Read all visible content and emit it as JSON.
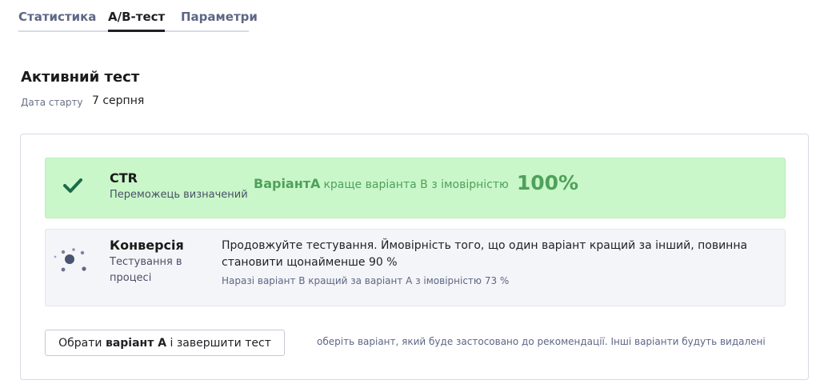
{
  "tabs": [
    {
      "label": "Статистика",
      "active": false
    },
    {
      "label": "А/В-тест",
      "active": true
    },
    {
      "label": "Параметри",
      "active": false
    }
  ],
  "page": {
    "title": "Активний тест",
    "start_label": "Дата старту",
    "start_value": "7 серпня"
  },
  "ctr": {
    "name": "CTR",
    "status": "Переможець визначений",
    "winner_variant": "ВаріантА",
    "winner_text": "краще варіанта В з імовірністю",
    "winner_pct": "100%",
    "icon": "check-icon"
  },
  "conversion": {
    "name": "Конверсія",
    "status": "Тестування в процесі",
    "message": "Продовжуйте тестування. Ймовірність того, що один варіант кращий за інший, повинна становити щонайменше 90 %",
    "note": "Наразі варіант В кращий за варіант А з імовірністю 73 %",
    "icon": "loading-icon"
  },
  "action": {
    "button_prefix": "Обрати ",
    "button_bold": "варіант А",
    "button_suffix": " і завершити тест",
    "hint": "оберіть варіант, який буде застосовано до рекомендації. Інші варіанти будуть видалені"
  },
  "colors": {
    "success_bg": "#c9f7c9",
    "success_text": "#4fa15a",
    "check": "#1c6b4a",
    "muted_text": "#5d6786"
  }
}
